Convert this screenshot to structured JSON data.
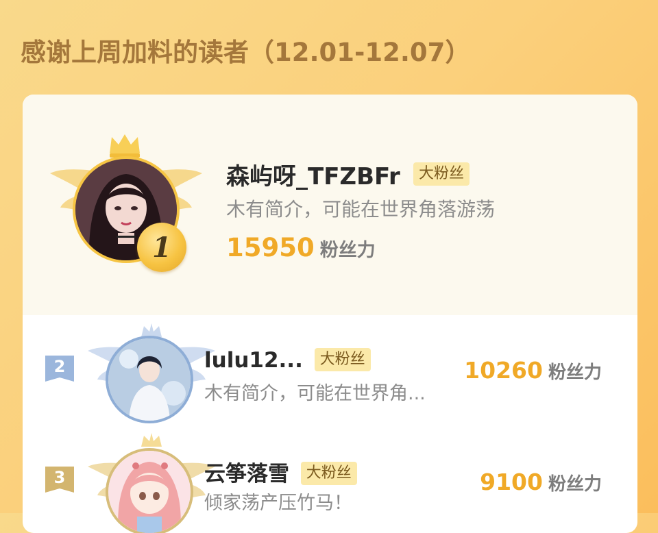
{
  "page": {
    "title": "感谢上周加料的读者（12.01-12.07）"
  },
  "champion": {
    "rank": "1",
    "name": "森屿呀_TFZBFr",
    "tag": "大粉丝",
    "bio": "木有简介，可能在世界角落游荡",
    "score": "15950",
    "score_unit": "粉丝力",
    "avatar_icon": "avatar-girl",
    "crown_icon": "crown-icon"
  },
  "readers": [
    {
      "rank": "2",
      "name": "lulu12...",
      "tag": "大粉丝",
      "bio": "木有简介，可能在世界角...",
      "score": "10260",
      "score_unit": "粉丝力",
      "badge_color": "#9bb6dc"
    },
    {
      "rank": "3",
      "name": "云筝落雪",
      "tag": "大粉丝",
      "bio": "倾家荡产压竹马！",
      "score": "9100",
      "score_unit": "粉丝力",
      "badge_color": "#d3b56f"
    }
  ],
  "colors": {
    "accent": "#f0a927",
    "title": "#a4773b",
    "tag_bg": "#fbe9a9"
  }
}
